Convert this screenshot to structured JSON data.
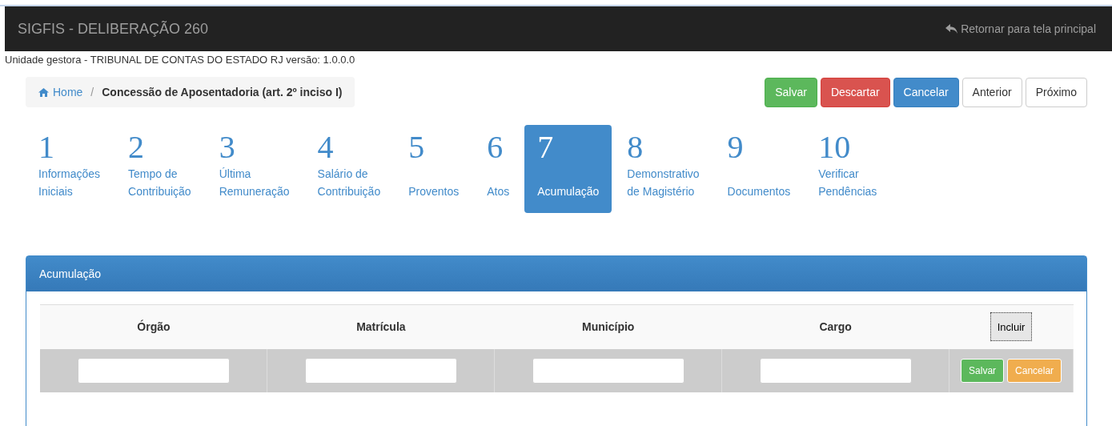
{
  "navbar": {
    "title": "SIGFIS - DELIBERAÇÃO 260",
    "return_link": "Retornar para tela principal"
  },
  "info_line": "Unidade gestora - TRIBUNAL DE CONTAS DO ESTADO RJ versão: 1.0.0.0",
  "breadcrumb": {
    "home": "Home",
    "separator": "/",
    "current": "Concessão de Aposentadoria (art. 2º inciso I)"
  },
  "actions": [
    {
      "label": "Salvar",
      "kind": "success"
    },
    {
      "label": "Descartar",
      "kind": "danger"
    },
    {
      "label": "Cancelar",
      "kind": "primary"
    },
    {
      "label": "Anterior",
      "kind": "default"
    },
    {
      "label": "Próximo",
      "kind": "default"
    }
  ],
  "steps": [
    {
      "number": "1",
      "label": "Informações\nIniciais",
      "selected": false
    },
    {
      "number": "2",
      "label": "Tempo de\nContribuição",
      "selected": false
    },
    {
      "number": "3",
      "label": "Última\nRemuneração",
      "selected": false
    },
    {
      "number": "4",
      "label": "Salário de\nContribuição",
      "selected": false
    },
    {
      "number": "5",
      "label": "Proventos",
      "selected": false
    },
    {
      "number": "6",
      "label": "Atos",
      "selected": false
    },
    {
      "number": "7",
      "label": "Acumulação",
      "selected": true
    },
    {
      "number": "8",
      "label": "Demonstrativo\nde Magistério",
      "selected": false
    },
    {
      "number": "9",
      "label": "Documentos",
      "selected": false
    },
    {
      "number": "10",
      "label": "Verificar\nPendências",
      "selected": false
    }
  ],
  "panel": {
    "title": "Acumulação",
    "table": {
      "columns": [
        "Órgão",
        "Matrícula",
        "Município",
        "Cargo"
      ],
      "add_button": "Incluir",
      "row_buttons": [
        {
          "label": "Salvar",
          "kind": "success"
        },
        {
          "label": "Cancelar",
          "kind": "warning"
        }
      ]
    }
  }
}
